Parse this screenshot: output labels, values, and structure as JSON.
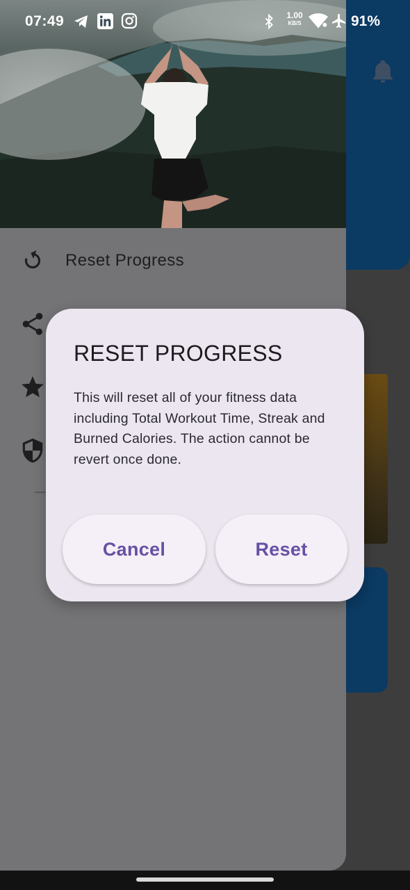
{
  "status_bar": {
    "time": "07:49",
    "battery": "91%",
    "net_speed_value": "1.00",
    "net_speed_unit": "KB/S",
    "icons": [
      "telegram-icon",
      "linkedin-icon",
      "instagram-icon",
      "bluetooth-icon",
      "wifi-icon",
      "airplane-mode-icon"
    ]
  },
  "drawer": {
    "items": [
      {
        "label": "Reset Progress",
        "icon": "reset-icon"
      },
      {
        "label": "",
        "icon": "share-icon"
      },
      {
        "label": "",
        "icon": "star-icon"
      },
      {
        "label": "",
        "icon": "shield-icon"
      }
    ]
  },
  "dialog": {
    "title": "RESET PROGRESS",
    "message": "This will reset all of your fitness data including Total Workout Time, Streak and Burned Calories. The action cannot be revert once done.",
    "cancel_label": "Cancel",
    "confirm_label": "Reset"
  },
  "colors": {
    "accent": "#6750a4",
    "dialog_bg": "#ece6f0",
    "header_blue": "#0b3a63",
    "scrim": "#747376"
  }
}
